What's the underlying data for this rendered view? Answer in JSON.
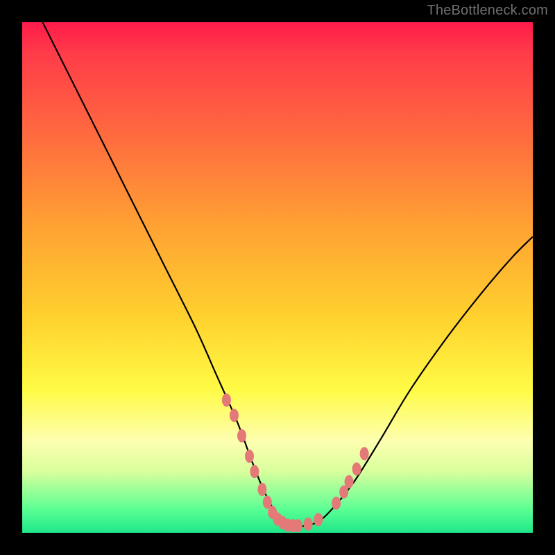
{
  "watermark": "TheBottleneck.com",
  "chart_data": {
    "type": "line",
    "title": "",
    "xlabel": "",
    "ylabel": "",
    "xlim": [
      0,
      100
    ],
    "ylim": [
      0,
      100
    ],
    "series": [
      {
        "name": "bottleneck-curve",
        "x": [
          4,
          10,
          16,
          22,
          28,
          34,
          38,
          42,
          45,
          47,
          49,
          51,
          53,
          55,
          58,
          61,
          65,
          70,
          76,
          83,
          90,
          96,
          100
        ],
        "values": [
          100,
          88,
          76,
          64,
          52,
          40,
          31,
          22,
          14,
          9,
          5,
          2.5,
          1.3,
          1.3,
          2.2,
          5,
          10,
          18,
          28,
          38,
          47,
          54,
          58
        ]
      }
    ],
    "markers": {
      "name": "highlight-dots",
      "color": "#e47a78",
      "x": [
        40,
        41.5,
        43,
        44.5,
        45.5,
        47,
        48,
        49,
        50,
        51,
        52,
        53,
        54,
        56,
        58,
        61.5,
        63,
        64,
        65.5,
        67
      ],
      "values": [
        26,
        23,
        19,
        15,
        12,
        8.5,
        6,
        4,
        2.7,
        2.0,
        1.5,
        1.4,
        1.4,
        1.7,
        2.6,
        5.8,
        8,
        10,
        12.5,
        15.5
      ]
    }
  }
}
